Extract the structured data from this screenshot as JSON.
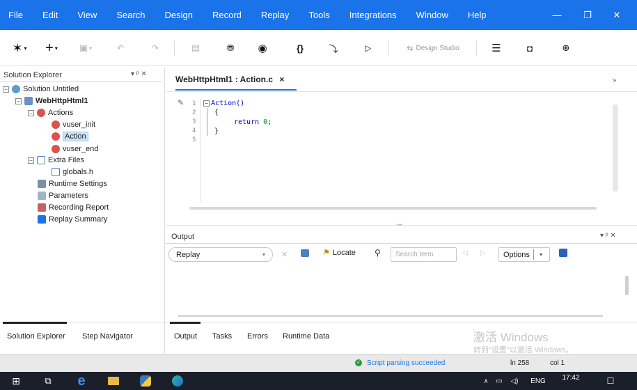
{
  "menu": [
    "File",
    "Edit",
    "View",
    "Search",
    "Design",
    "Record",
    "Replay",
    "Tools",
    "Integrations",
    "Window",
    "Help"
  ],
  "window_controls": {
    "minimize": "—",
    "restore": "❐",
    "close": "✕"
  },
  "toolbar": {
    "design_studio_label": "Design Studio"
  },
  "solution_explorer": {
    "title": "Solution Explorer",
    "pin": "▾ ᵖ ✕",
    "solution": "Solution Untitled",
    "project": "WebHttpHtml1",
    "actions": "Actions",
    "vuser_init": "vuser_init",
    "action": "Action",
    "vuser_end": "vuser_end",
    "extra_files": "Extra Files",
    "globals": "globals.h",
    "runtime_settings": "Runtime Settings",
    "parameters": "Parameters",
    "recording_report": "Recording Report",
    "replay_summary": "Replay Summary"
  },
  "editor": {
    "tab_label": "WebHttpHtml1 : Action.c",
    "tab_close": "×",
    "line_numbers": [
      "1",
      "2",
      "3",
      "4",
      "5"
    ],
    "code": {
      "line1": "Action()",
      "line2": "{",
      "line3_kw": "return",
      "line3_num": "0",
      "line3_end": ";",
      "line4": "}"
    }
  },
  "output": {
    "title": "Output",
    "pin": "▾ ᵖ ✕",
    "source_value": "Replay",
    "locate_label": "Locate",
    "search_placeholder": "Search term",
    "options_label": "Options"
  },
  "left_tabs": [
    "Solution Explorer",
    "Step Navigator"
  ],
  "bottom_tabs": [
    "Output",
    "Tasks",
    "Errors",
    "Runtime Data"
  ],
  "activation": {
    "line1": "激活 Windows",
    "line2": "转到\"设置\"以激活 Windows。"
  },
  "status": {
    "message": "Script parsing succeeded",
    "line": "ln 258",
    "col": "col 1"
  },
  "taskbar": {
    "lang": "ENG",
    "time": "17:42"
  },
  "colors": {
    "accent": "#1a73e8",
    "status_ok": "#2a9d3a"
  }
}
